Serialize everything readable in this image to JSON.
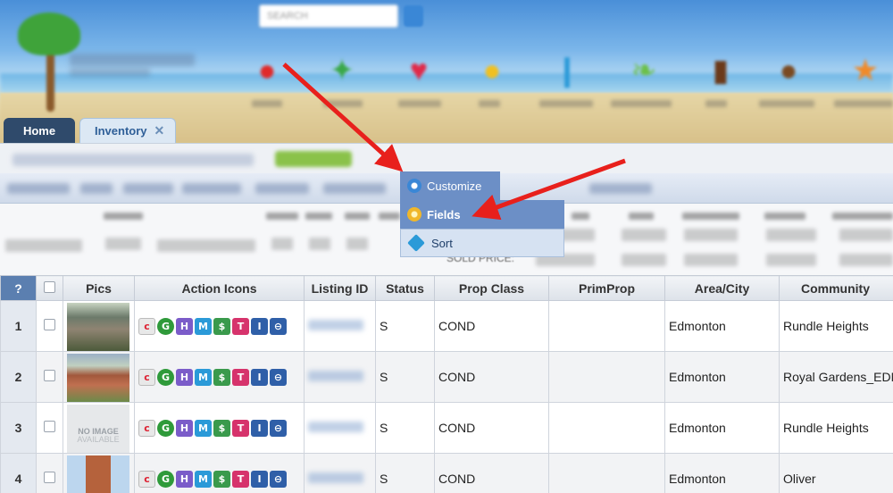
{
  "header": {
    "search_placeholder": "SEARCH"
  },
  "tabs": [
    {
      "label": "Home"
    },
    {
      "label": "Inventory",
      "close": "✕"
    }
  ],
  "menu": {
    "items": [
      {
        "label": "Customize",
        "icon": "gear-icon"
      },
      {
        "label": "Fields",
        "icon": "star-icon"
      },
      {
        "label": "Sort",
        "icon": "diamond-icon"
      }
    ]
  },
  "stats": {
    "sold_price_label": "SOLD PRICE:"
  },
  "grid": {
    "corner": "?",
    "columns": [
      "Pics",
      "Action Icons",
      "Listing ID",
      "Status",
      "Prop Class",
      "PrimProp",
      "Area/City",
      "Community"
    ],
    "action_icons": [
      "H",
      "M",
      "$",
      "T",
      "I",
      "⊖"
    ],
    "rows": [
      {
        "num": "1",
        "status": "S",
        "prop_class": "COND",
        "prim_prop": "",
        "area": "Edmonton",
        "community": "Rundle Heights"
      },
      {
        "num": "2",
        "status": "S",
        "prop_class": "COND",
        "prim_prop": "",
        "area": "Edmonton",
        "community": "Royal Gardens_EDMO"
      },
      {
        "num": "3",
        "status": "S",
        "prop_class": "COND",
        "prim_prop": "",
        "area": "Edmonton",
        "community": "Rundle Heights",
        "no_image": "NO IMAGE",
        "no_image_sub": "AVAILABLE"
      },
      {
        "num": "4",
        "status": "S",
        "prop_class": "COND",
        "prim_prop": "",
        "area": "Edmonton",
        "community": "Oliver"
      }
    ]
  },
  "colors": {
    "tab_home_bg": "#2f4a6b",
    "menu_bg": "#6c8fc6",
    "arrow": "#e8201c"
  }
}
